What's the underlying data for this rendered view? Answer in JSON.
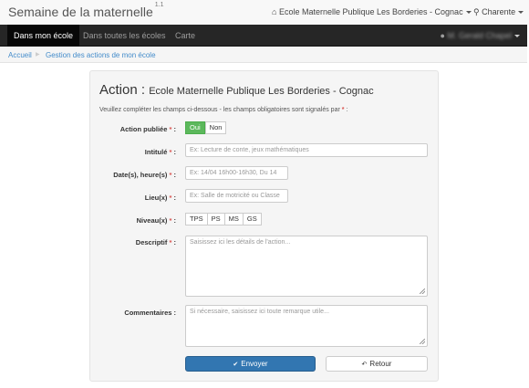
{
  "header": {
    "brand": "Semaine de la maternelle",
    "version": "1.1",
    "school_menu": "Ecole Maternelle Publique Les Borderies - Cognac",
    "department_menu": "Charente"
  },
  "nav": {
    "items": [
      "Dans mon école",
      "Dans toutes les écoles",
      "Carte"
    ],
    "user": "M. Gerald Chapel"
  },
  "breadcrumb": {
    "home": "Accueil",
    "current": "Gestion des actions de mon école"
  },
  "form": {
    "title_prefix": "Action :",
    "title_school": "Ecole Maternelle Publique Les Borderies - Cognac",
    "intro": "Veuillez compléter les champs ci-dessous - les champs obligatoires sont signalés par",
    "intro_tail": ":",
    "required_mark": "*",
    "published": {
      "label": "Action publiée",
      "yes": "Oui",
      "no": "Non",
      "value": "Oui"
    },
    "title": {
      "label": "Intitulé",
      "placeholder": "Ex: Lecture de conte, jeux mathématiques"
    },
    "dates": {
      "label": "Date(s), heure(s)",
      "placeholder": "Ex: 14/04 16h00-16h30, Du 14"
    },
    "place": {
      "label": "Lieu(x)",
      "placeholder": "Ex: Salle de motricité ou Classe"
    },
    "levels": {
      "label": "Niveau(x)",
      "options": [
        "TPS",
        "PS",
        "MS",
        "GS"
      ]
    },
    "description": {
      "label": "Descriptif",
      "placeholder": "Saisissez ici les détails de l'action..."
    },
    "comments": {
      "label": "Commentaires :",
      "placeholder": "Si nécessaire, saisissez ici toute remarque utile..."
    },
    "submit_label": "Envoyer",
    "back_label": "Retour"
  }
}
